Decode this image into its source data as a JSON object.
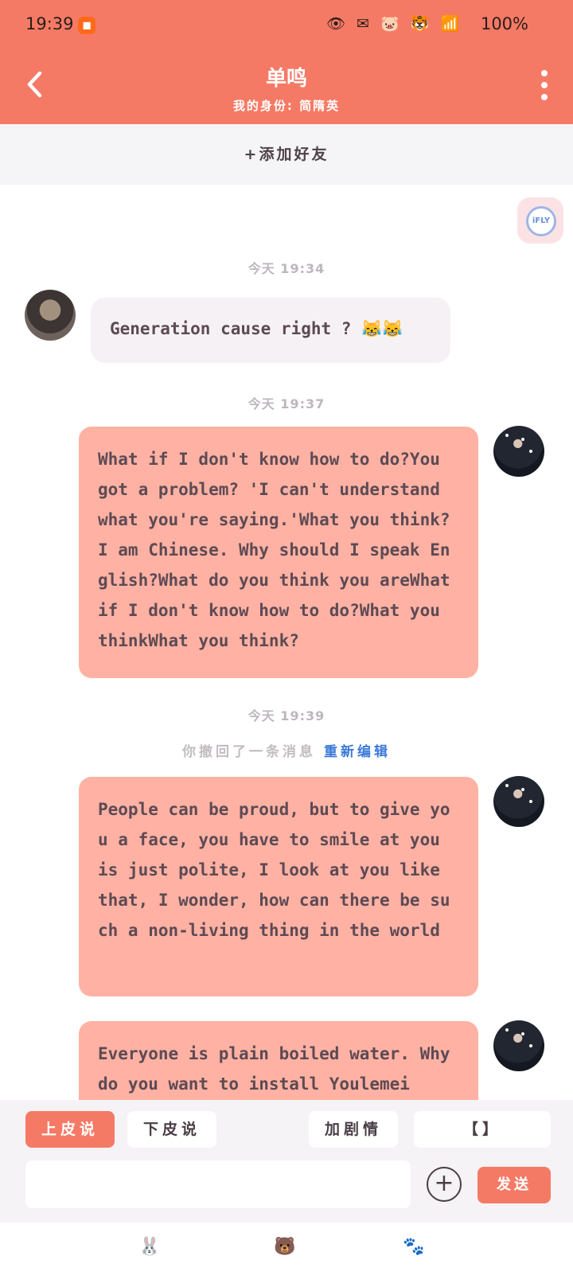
{
  "status_bar": {
    "time": "19:39",
    "app_icon": "kuaishou-icon",
    "icons": "👁 ✉ 🐷 🐯 📶",
    "battery": "100%"
  },
  "header": {
    "title": "单鸣",
    "subtitle": "我的身份: 简隋英"
  },
  "add_friend": "+添加好友",
  "float_badge": "iFLY",
  "messages": {
    "t1": "今天 19:34",
    "m1": "Generation cause right ? 😹😹",
    "t2": "今天 19:37",
    "m2": "What if I don't know how to do?You got a problem? 'I can't understand what you're saying.'What you think? I am Chinese. Why should I speak English?What do you think you areWhat if I don't know how to do?What you thinkWhat you think?",
    "t3": "今天 19:39",
    "recall_text": "你撤回了一条消息",
    "recall_edit": "重新编辑",
    "m3": "People can be proud, but to give you a face, you have to smile at you is just polite, I look at you like that, I wonder, how can there be such a non-living thing in the world",
    "m4": "Everyone is plain boiled water. Why do you want to install Youlemei"
  },
  "toolbar": {
    "btn1": "上皮说",
    "btn2": "下皮说",
    "btn3": "加剧情",
    "btn4": "【】"
  },
  "composer": {
    "placeholder": "",
    "send": "发送"
  },
  "tabs": [
    "🐰",
    "🐻",
    "🐾"
  ],
  "colors": {
    "accent": "#f57a66",
    "bubble_right": "#ffb2a3",
    "bubble_left": "#f6f1f4",
    "link": "#3a79d8"
  }
}
